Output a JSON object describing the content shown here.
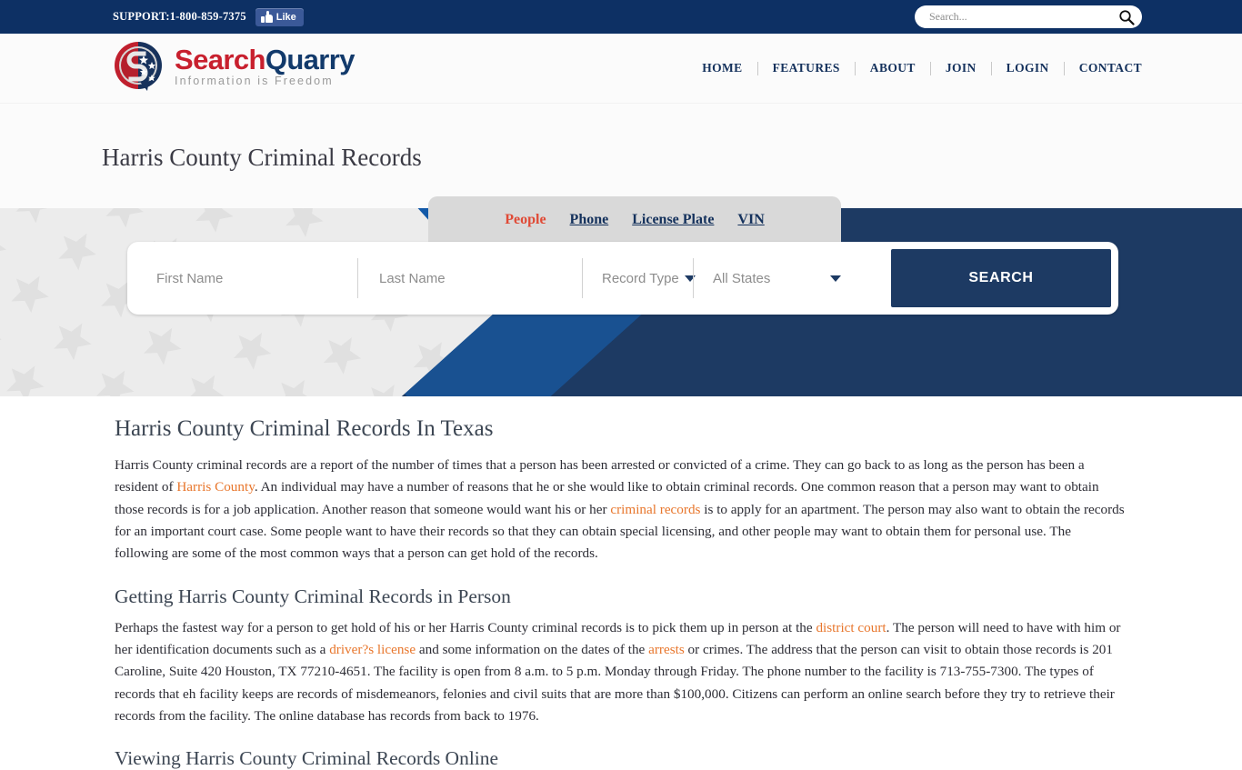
{
  "topbar": {
    "support": "SUPPORT:1-800-859-7375",
    "facebook_like": "Like",
    "search_placeholder": "Search...",
    "search_value": "",
    "bg_color": "#0d3064"
  },
  "header": {
    "logo": {
      "title_part1": "Search",
      "title_part2": "Quarry",
      "tagline": "Information is Freedom",
      "red": "#c8202e",
      "navy": "#123a6b"
    },
    "nav": [
      {
        "label": "HOME"
      },
      {
        "label": "FEATURES"
      },
      {
        "label": "ABOUT"
      },
      {
        "label": "JOIN"
      },
      {
        "label": "LOGIN"
      },
      {
        "label": "CONTACT"
      }
    ]
  },
  "page_title": "Harris County Criminal Records",
  "hero": {
    "bg_color": "#1d3a63",
    "tabs": [
      {
        "label": "People",
        "active": true
      },
      {
        "label": "Phone",
        "active": false
      },
      {
        "label": "License Plate",
        "active": false
      },
      {
        "label": "VIN",
        "active": false
      }
    ],
    "form": {
      "first_name_placeholder": "First Name",
      "first_name_value": "",
      "last_name_placeholder": "Last Name",
      "last_name_value": "",
      "record_type_label": "Record Type",
      "state_label": "All States",
      "search_button": "SEARCH",
      "button_color": "#1d3a63"
    }
  },
  "article": {
    "h2": "Harris County Criminal Records In Texas",
    "p1_a": "Harris County criminal records are a report of the number of times that a person has been arrested or convicted of a crime. They can go back to as long as the person has been a resident of ",
    "p1_link1": "Harris County",
    "p1_b": ". An individual may have a number of reasons that he or she would like to obtain criminal records. One common reason that a person may want to obtain those records is for a job application. Another reason that someone would want his or her ",
    "p1_link2": "criminal records",
    "p1_c": " is to apply for an apartment. The person may also want to obtain the records for an important court case. Some people want to have their records so that they can obtain special licensing, and other people may want to obtain them for personal use. The following are some of the most common ways that a person can get hold of the records.",
    "h3_1": "Getting Harris County Criminal Records in Person",
    "p2_a": "Perhaps the fastest way for a person to get hold of his or her Harris County criminal records is to pick them up in person at the ",
    "p2_link1": "district court",
    "p2_b": ". The person will need to have with him or her identification documents such as a ",
    "p2_link2": "driver?s license",
    "p2_c": " and some information on the dates of the ",
    "p2_link3": "arrests",
    "p2_d": " or crimes. The address that the person can visit to obtain those records is 201 Caroline, Suite 420 Houston, TX 77210-4651. The facility is open from 8 a.m. to 5 p.m. Monday through Friday. The phone number to the facility is 713-755-7300. The types of records that eh facility keeps are records of misdemeanors, felonies and civil suits that are more than $100,000. Citizens can perform an online search before they try to retrieve their records from the facility. The online database has records from back to 1976.",
    "h3_2": "Viewing Harris County Criminal Records Online",
    "link_color": "#e8762c"
  }
}
